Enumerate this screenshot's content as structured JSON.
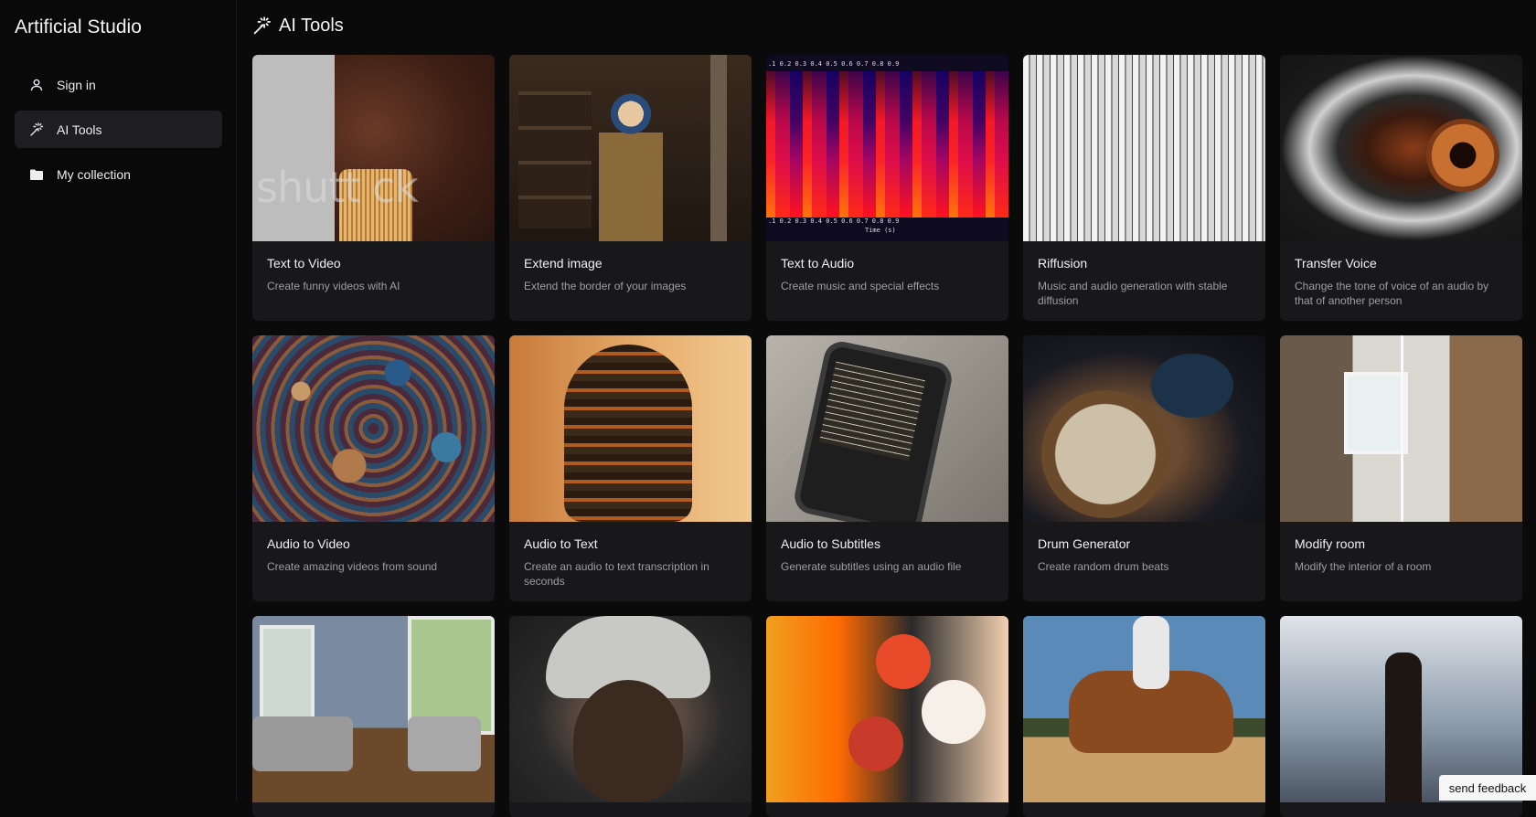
{
  "app": {
    "title": "Artificial Studio"
  },
  "sidebar": {
    "items": [
      {
        "label": "Sign in",
        "icon": "user-icon",
        "active": false
      },
      {
        "label": "AI Tools",
        "icon": "magic-wand-icon",
        "active": true
      },
      {
        "label": "My collection",
        "icon": "folder-icon",
        "active": false
      }
    ]
  },
  "main": {
    "title": "AI Tools",
    "title_icon": "magic-wand-icon",
    "cards": [
      {
        "title": "Text to Video",
        "description": "Create funny videos with AI",
        "thumb_watermark": "shutt     ck"
      },
      {
        "title": "Extend image",
        "description": "Extend the border of your images"
      },
      {
        "title": "Text to Audio",
        "description": "Create music and special effects",
        "thumb_scale_top": ".1    0.2    0.3    0.4    0.5    0.6    0.7    0.8    0.9",
        "thumb_scale_bottom": ".1    0.2    0.3    0.4    0.5    0.6    0.7    0.8    0.9",
        "thumb_axis_label": "Time (s)"
      },
      {
        "title": "Riffusion",
        "description": "Music and audio generation with stable diffusion"
      },
      {
        "title": "Transfer Voice",
        "description": "Change the tone of voice of an audio by that of another person"
      },
      {
        "title": "Audio to Video",
        "description": "Create amazing videos from sound"
      },
      {
        "title": "Audio to Text",
        "description": "Create an audio to text transcription in seconds"
      },
      {
        "title": "Audio to Subtitles",
        "description": "Generate subtitles using an audio file"
      },
      {
        "title": "Drum Generator",
        "description": "Create random drum beats"
      },
      {
        "title": "Modify room",
        "description": "Modify the interior of a room"
      },
      {
        "title": "",
        "description": ""
      },
      {
        "title": "",
        "description": ""
      },
      {
        "title": "",
        "description": ""
      },
      {
        "title": "",
        "description": ""
      },
      {
        "title": "",
        "description": ""
      }
    ]
  },
  "feedback": {
    "label": "send feedback"
  }
}
